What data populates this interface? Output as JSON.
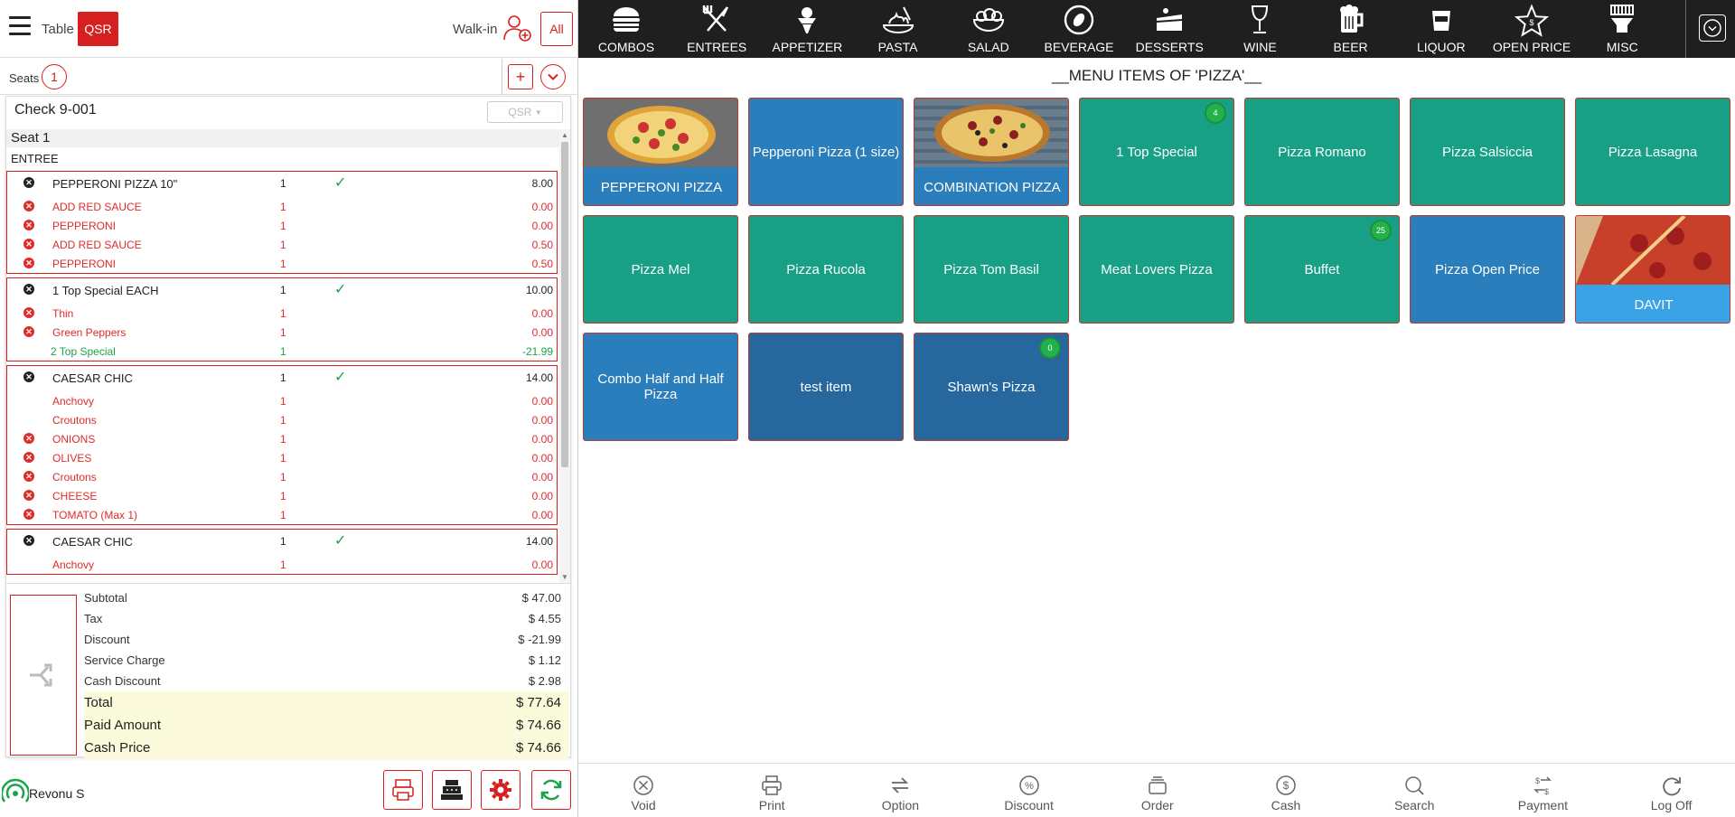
{
  "header": {
    "table_label": "Table",
    "qsr_label": "QSR",
    "walkin_label": "Walk-in",
    "all_label": "All"
  },
  "seats": {
    "label": "Seats",
    "count": "1",
    "add": "+"
  },
  "check": {
    "title": "Check 9-001",
    "order_type": "QSR",
    "seat": "Seat 1",
    "course": "ENTREE",
    "groups": [
      {
        "lines": [
          {
            "kind": "main",
            "name": "PEPPERONI PIZZA 10\"",
            "qty": "1",
            "sent": true,
            "price": "8.00"
          },
          {
            "kind": "mod",
            "x": true,
            "name": "ADD RED SAUCE",
            "qty": "1",
            "price": "0.00"
          },
          {
            "kind": "mod",
            "x": true,
            "name": "PEPPERONI",
            "qty": "1",
            "price": "0.00"
          },
          {
            "kind": "mod",
            "x": true,
            "name": "ADD RED SAUCE",
            "qty": "1",
            "price": "0.50"
          },
          {
            "kind": "mod",
            "x": true,
            "name": "PEPPERONI",
            "qty": "1",
            "price": "0.50"
          }
        ]
      },
      {
        "lines": [
          {
            "kind": "main",
            "name": "1 Top Special EACH",
            "qty": "1",
            "sent": true,
            "price": "10.00"
          },
          {
            "kind": "mod",
            "x": true,
            "name": "Thin",
            "qty": "1",
            "price": "0.00"
          },
          {
            "kind": "mod",
            "x": true,
            "name": "Green Peppers",
            "qty": "1",
            "price": "0.00"
          },
          {
            "kind": "disc",
            "x": false,
            "name": "2 Top Special",
            "qty": "1",
            "price": "-21.99"
          }
        ]
      },
      {
        "lines": [
          {
            "kind": "main",
            "name": "CAESAR CHIC",
            "qty": "1",
            "sent": true,
            "price": "14.00"
          },
          {
            "kind": "mod",
            "x": false,
            "name": "Anchovy",
            "qty": "1",
            "price": "0.00"
          },
          {
            "kind": "mod",
            "x": false,
            "name": "Croutons",
            "qty": "1",
            "price": "0.00"
          },
          {
            "kind": "mod",
            "x": true,
            "name": "ONIONS",
            "qty": "1",
            "price": "0.00"
          },
          {
            "kind": "mod",
            "x": true,
            "name": "OLIVES",
            "qty": "1",
            "price": "0.00"
          },
          {
            "kind": "mod",
            "x": true,
            "name": "Croutons",
            "qty": "1",
            "price": "0.00"
          },
          {
            "kind": "mod",
            "x": true,
            "name": "CHEESE",
            "qty": "1",
            "price": "0.00"
          },
          {
            "kind": "mod",
            "x": true,
            "name": "TOMATO (Max 1)",
            "qty": "1",
            "price": "0.00"
          }
        ]
      },
      {
        "lines": [
          {
            "kind": "main",
            "name": "CAESAR CHIC",
            "qty": "1",
            "sent": true,
            "price": "14.00"
          },
          {
            "kind": "mod",
            "x": false,
            "name": "Anchovy",
            "qty": "1",
            "price": "0.00"
          }
        ]
      }
    ],
    "totals": [
      {
        "label": "Subtotal",
        "value": "$ 47.00",
        "big": false
      },
      {
        "label": "Tax",
        "value": "$ 4.55",
        "big": false
      },
      {
        "label": "Discount",
        "value": "$ -21.99",
        "big": false
      },
      {
        "label": "Service Charge",
        "value": "$ 1.12",
        "big": false
      },
      {
        "label": "Cash Discount",
        "value": "$ 2.98",
        "big": false
      },
      {
        "label": "Total",
        "value": "$ 77.64",
        "big": true
      },
      {
        "label": "Paid Amount",
        "value": "$ 74.66",
        "big": true
      },
      {
        "label": "Cash Price",
        "value": "$ 74.66",
        "big": true
      }
    ]
  },
  "footer_left": {
    "user": "Revonu S"
  },
  "categories": [
    {
      "label": "COMBOS",
      "icon": "burger-icon"
    },
    {
      "label": "ENTREES",
      "icon": "fork-knife-icon"
    },
    {
      "label": "APPETIZER",
      "icon": "ice-cream-icon"
    },
    {
      "label": "PASTA",
      "icon": "pasta-icon"
    },
    {
      "label": "SALAD",
      "icon": "salad-icon"
    },
    {
      "label": "BEVERAGE",
      "icon": "beverage-icon"
    },
    {
      "label": "DESSERTS",
      "icon": "cake-icon"
    },
    {
      "label": "WINE",
      "icon": "wine-glass-icon"
    },
    {
      "label": "BEER",
      "icon": "beer-mug-icon"
    },
    {
      "label": "LIQUOR",
      "icon": "liquor-glass-icon"
    },
    {
      "label": "OPEN PRICE",
      "icon": "star-icon"
    },
    {
      "label": "MISC",
      "icon": "misc-icon"
    }
  ],
  "menu": {
    "title": "__MENU ITEMS OF 'PIZZA'__",
    "items": [
      {
        "label": "PEPPERONI PIZZA",
        "color": "blue",
        "image": "pepperoni"
      },
      {
        "label": "Pepperoni Pizza (1 size)",
        "color": "blue"
      },
      {
        "label": "COMBINATION PIZZA",
        "color": "blue",
        "image": "combo"
      },
      {
        "label": "1 Top Special",
        "color": "teal",
        "badge": "4"
      },
      {
        "label": "Pizza Romano",
        "color": "teal"
      },
      {
        "label": "Pizza Salsiccia",
        "color": "teal"
      },
      {
        "label": "Pizza Lasagna",
        "color": "teal"
      },
      {
        "label": "Pizza Mel",
        "color": "teal"
      },
      {
        "label": "Pizza Rucola",
        "color": "teal"
      },
      {
        "label": "Pizza Tom Basil",
        "color": "teal"
      },
      {
        "label": "Meat Lovers Pizza",
        "color": "teal"
      },
      {
        "label": "Buffet",
        "color": "teal",
        "badge": "25"
      },
      {
        "label": "Pizza Open Price",
        "color": "blue"
      },
      {
        "label": "DAVIT",
        "color": "lightblue",
        "image": "slice"
      },
      {
        "label": "Combo Half and Half Pizza",
        "color": "blue"
      },
      {
        "label": "test item",
        "color": "dark"
      },
      {
        "label": "Shawn's Pizza",
        "color": "dark",
        "badge": "0"
      }
    ]
  },
  "actions": [
    {
      "label": "Void",
      "icon": "void-icon"
    },
    {
      "label": "Print",
      "icon": "printer-icon"
    },
    {
      "label": "Option",
      "icon": "option-icon"
    },
    {
      "label": "Discount",
      "icon": "discount-icon"
    },
    {
      "label": "Order",
      "icon": "order-icon"
    },
    {
      "label": "Cash",
      "icon": "cash-icon"
    },
    {
      "label": "Search",
      "icon": "search-icon"
    },
    {
      "label": "Payment",
      "icon": "payment-icon"
    },
    {
      "label": "Log Off",
      "icon": "log-off-icon"
    }
  ],
  "colors": {
    "accent_red": "#d62020",
    "teal_tile": "#17a085",
    "blue_tile": "#2a7ebb",
    "dark_tile": "#26689e",
    "category_bar": "#1f1f1f"
  }
}
